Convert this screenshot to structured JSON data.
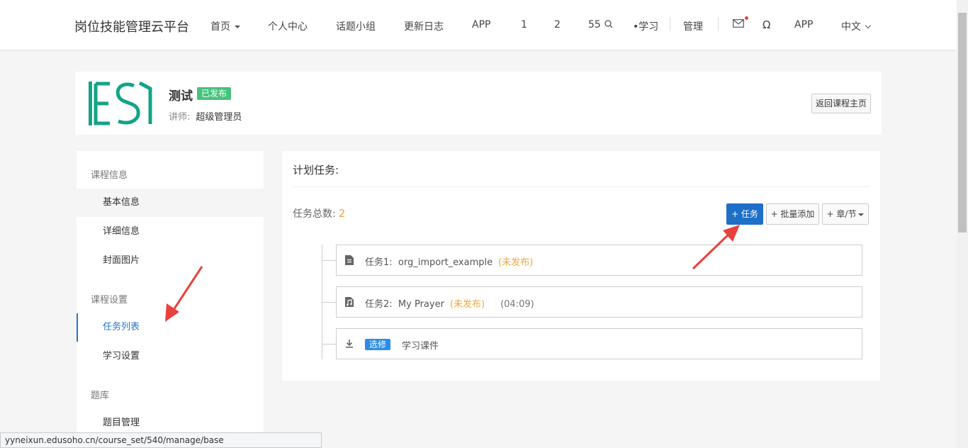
{
  "nav": {
    "brand": "岗位技能管理云平台",
    "items": [
      "首页",
      "个人中心",
      "话题小组",
      "更新日志",
      "APP",
      "1",
      "2",
      "55",
      "•学习",
      "管理",
      "APP",
      "中文"
    ]
  },
  "course": {
    "title": "测试",
    "status": "已发布",
    "teacher_label": "讲师:",
    "teacher_name": "超级管理员",
    "back_button": "返回课程主页"
  },
  "sidebar": {
    "groups": [
      {
        "title": "课程信息",
        "items": [
          "基本信息",
          "详细信息",
          "封面图片"
        ]
      },
      {
        "title": "课程设置",
        "items": [
          "任务列表",
          "学习设置"
        ]
      },
      {
        "title": "题库",
        "items": [
          "题目管理"
        ]
      }
    ]
  },
  "main": {
    "title": "计划任务:",
    "count_label": "任务总数:",
    "count_value": "2",
    "add_task": "+ 任务",
    "batch_add": "+ 批量添加",
    "chapter": "+ 章/节",
    "tasks": [
      {
        "label": "任务1:",
        "name": "org_import_example",
        "status": "(未发布)",
        "duration": ""
      },
      {
        "label": "任务2:",
        "name": "My Prayer",
        "status": "(未发布)",
        "duration": "(04:09)"
      }
    ],
    "material": {
      "badge": "选修",
      "name": "学习课件"
    }
  },
  "statusbar": {
    "url": "yyneixun.edusoho.cn/course_set/540/manage/base"
  },
  "colors": {
    "accent": "#2b74c7",
    "primary_button": "#1e6fc8",
    "published": "#46c37b",
    "unpublished": "#f0a63b",
    "arrow": "#e8413e"
  }
}
